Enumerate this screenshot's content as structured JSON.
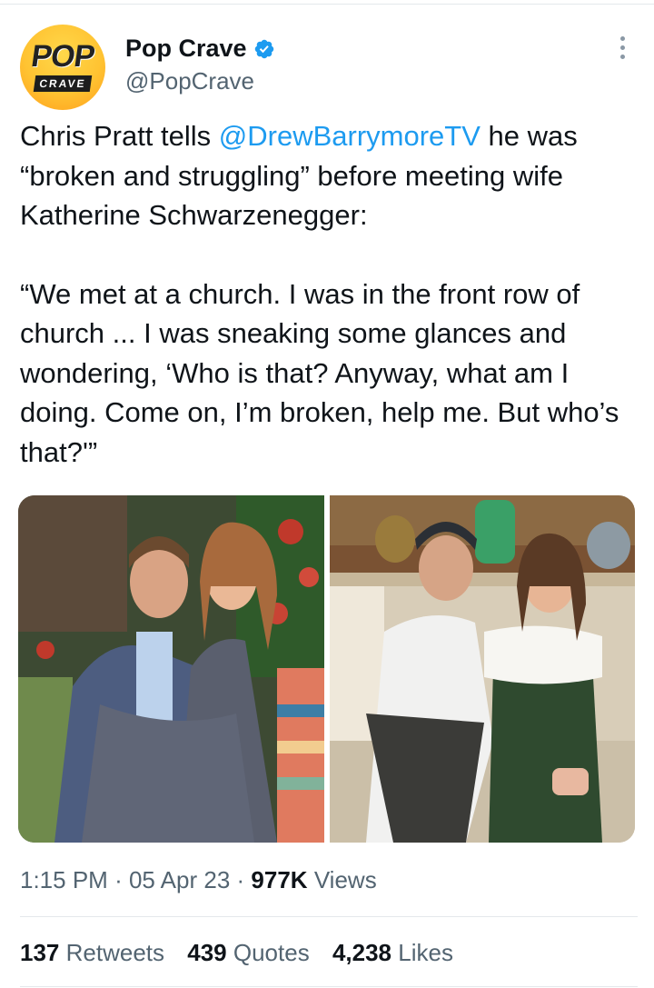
{
  "author": {
    "display_name": "Pop Crave",
    "handle": "@PopCrave",
    "avatar_text_top": "POP",
    "avatar_text_bottom": "CRAVE",
    "verified_icon": "verified-badge-icon"
  },
  "tweet": {
    "line1_prefix": "Chris Pratt tells ",
    "mention": "@DrewBarrymoreTV",
    "line1_suffix": " he was “broken and struggling” before meeting wife Katherine Schwarzenegger:",
    "quote": "“We met at a church. I was in the front row of church ... I was sneaking some glances and wondering, ‘Who is that? Anyway, what am I doing. Come on, I’m broken, help me. But who’s that?'”"
  },
  "meta": {
    "time": "1:15 PM",
    "separator": "·",
    "date": "05 Apr 23",
    "views_count": "977K",
    "views_label": "Views"
  },
  "stats": {
    "retweets_count": "137",
    "retweets_label": "Retweets",
    "quotes_count": "439",
    "quotes_label": "Quotes",
    "likes_count": "4,238",
    "likes_label": "Likes"
  },
  "colors": {
    "link": "#1d9bf0",
    "text": "#0f1419",
    "secondary": "#536471",
    "divider": "#e4e8eb",
    "avatar_bg": "#ffc332"
  }
}
